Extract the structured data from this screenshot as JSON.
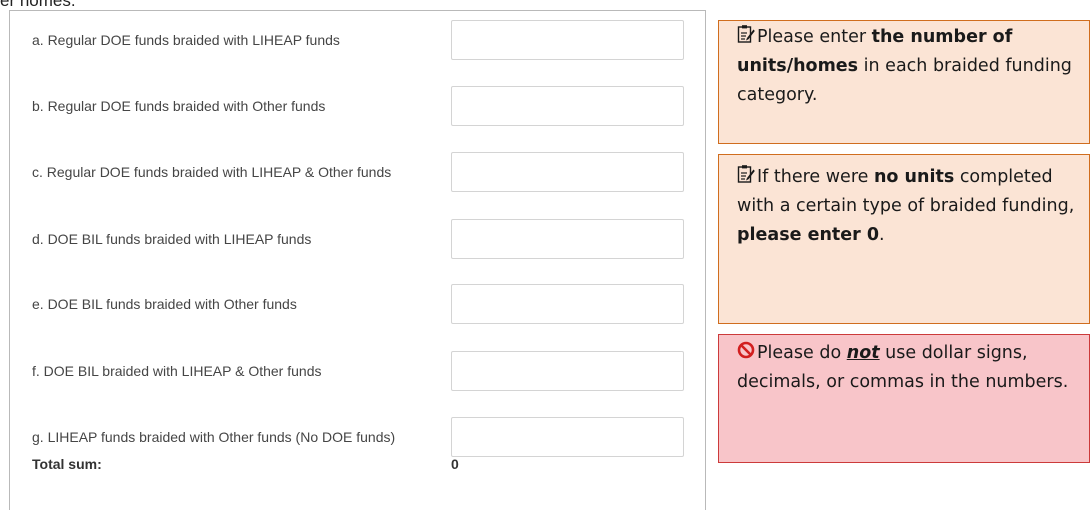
{
  "header_fragment": "er homes.",
  "form": {
    "rows": [
      {
        "label": "a. Regular DOE funds braided with LIHEAP funds",
        "value": ""
      },
      {
        "label": "b. Regular DOE funds braided with Other funds",
        "value": ""
      },
      {
        "label": "c. Regular DOE funds braided with LIHEAP & Other funds",
        "value": ""
      },
      {
        "label": "d. DOE BIL funds braided with LIHEAP funds",
        "value": ""
      },
      {
        "label": "e. DOE BIL funds braided with Other funds",
        "value": ""
      },
      {
        "label": "f. DOE BIL braided with LIHEAP & Other funds",
        "value": ""
      },
      {
        "label": "g. LIHEAP funds braided with Other funds (No DOE funds)",
        "value": ""
      }
    ],
    "total_label": "Total sum:",
    "total_value": "0"
  },
  "callouts": {
    "units": {
      "icon": "memo-icon",
      "pre": "Please enter ",
      "bold": "the number of units/homes",
      "post": " in each braided funding category."
    },
    "zero": {
      "icon": "memo-icon",
      "pre": "If there were ",
      "bold1": "no units",
      "mid": " completed with a certain type of braided funding, ",
      "bold2": "please enter 0",
      "post": "."
    },
    "format": {
      "icon": "prohibited-icon",
      "pre": "Please do ",
      "emph": "not",
      "post": " use dollar signs, decimals, or commas in the numbers."
    }
  },
  "colors": {
    "info_bg": "#fbe4d5",
    "info_border": "#d06d1e",
    "warn_bg": "#f8c5c9",
    "warn_border": "#cc3a3a",
    "prohibited_icon": "#d21f1f"
  }
}
